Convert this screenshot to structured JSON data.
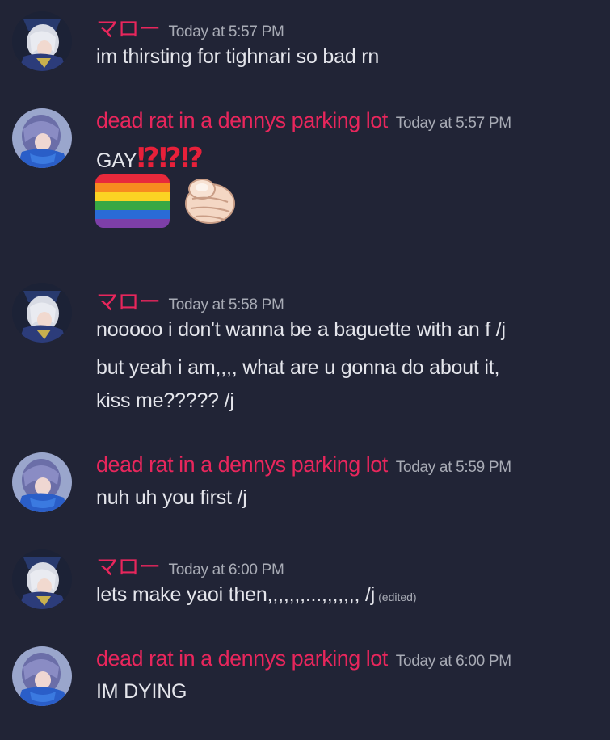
{
  "colors": {
    "background": "#212436",
    "username": "#e8265c",
    "timestamp": "#a8abb5",
    "message_text": "#e4e5eb",
    "interrobang": "#e8203a"
  },
  "users": {
    "marlowe": {
      "name": "マロー",
      "avatar": "white-haired-character-avatar"
    },
    "deadrat": {
      "name": "dead rat in a dennys parking lot",
      "avatar": "purple-haired-character-avatar"
    }
  },
  "messages": [
    {
      "author": "マロー",
      "timestamp": "Today at 5:57 PM",
      "lines": [
        "im thirsting for tighnari so bad rn"
      ]
    },
    {
      "author": "dead rat in a dennys parking lot",
      "timestamp": "Today at 5:57 PM",
      "lines": [
        "GAY"
      ],
      "emphasis": "⁉⁉⁉",
      "emoji": [
        "rainbow-flag-icon",
        "pointing-finger-icon"
      ]
    },
    {
      "author": "マロー",
      "timestamp": "Today at 5:58 PM",
      "lines": [
        "nooooo i don't wanna be a baguette with an f /j",
        "but yeah i am,,,, what are u gonna do about it,",
        "kiss me????? /j"
      ]
    },
    {
      "author": "dead rat in a dennys parking lot",
      "timestamp": "Today at 5:59 PM",
      "lines": [
        "nuh uh you first /j"
      ]
    },
    {
      "author": "マロー",
      "timestamp": "Today at 6:00 PM",
      "lines": [
        "lets make yaoi then,,,,,,,...,,,,,,, /j"
      ],
      "edited_label": "(edited)"
    },
    {
      "author": "dead rat in a dennys parking lot",
      "timestamp": "Today at 6:00 PM",
      "lines": [
        "IM DYING"
      ]
    }
  ]
}
